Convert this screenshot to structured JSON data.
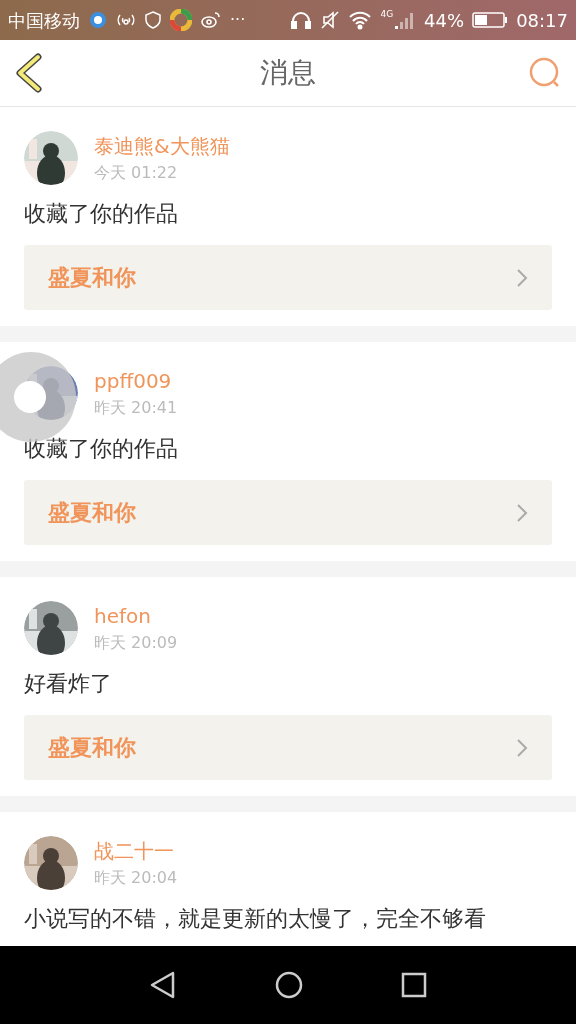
{
  "status_bar": {
    "carrier": "中国移动",
    "more": "···",
    "network": "4G",
    "battery": "44%",
    "time": "08:17"
  },
  "header": {
    "title": "消息"
  },
  "messages": [
    {
      "name": "泰迪熊&大熊猫",
      "time": "今天 01:22",
      "text": "收藏了你的作品",
      "work": "盛夏和你"
    },
    {
      "name": "ppff009",
      "time": "昨天 20:41",
      "text": "收藏了你的作品",
      "work": "盛夏和你"
    },
    {
      "name": "hefon",
      "time": "昨天 20:09",
      "text": "好看炸了",
      "work": "盛夏和你"
    },
    {
      "name": "战二十一",
      "time": "昨天 20:04",
      "text": "小说写的不错，就是更新的太慢了，完全不够看"
    }
  ]
}
